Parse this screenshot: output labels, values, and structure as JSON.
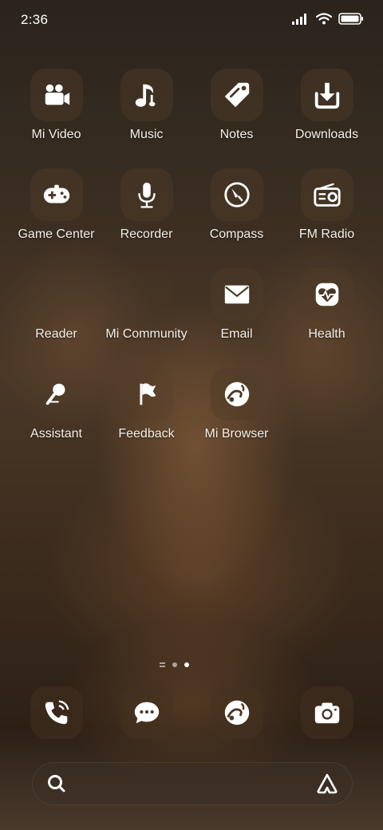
{
  "status_bar": {
    "time": "2:36",
    "icons": [
      "signal-icon",
      "wifi-icon",
      "battery-icon"
    ]
  },
  "apps": [
    {
      "label": "Mi Video",
      "icon": "video-camera-icon"
    },
    {
      "label": "Music",
      "icon": "music-note-icon"
    },
    {
      "label": "Notes",
      "icon": "notes-icon"
    },
    {
      "label": "Downloads",
      "icon": "download-icon"
    },
    {
      "label": "Game Center",
      "icon": "gamepad-icon"
    },
    {
      "label": "Recorder",
      "icon": "microphone-icon"
    },
    {
      "label": "Compass",
      "icon": "compass-icon"
    },
    {
      "label": "FM Radio",
      "icon": "radio-icon"
    },
    {
      "label": "Reader",
      "icon": "reader-icon"
    },
    {
      "label": "Mi Community",
      "icon": "community-icon"
    },
    {
      "label": "Email",
      "icon": "envelope-icon"
    },
    {
      "label": "Health",
      "icon": "heart-pulse-icon"
    },
    {
      "label": "Assistant",
      "icon": "assistant-mic-icon"
    },
    {
      "label": "Feedback",
      "icon": "flag-icon"
    },
    {
      "label": "Mi Browser",
      "icon": "browser-icon"
    }
  ],
  "page_indicator": {
    "pages": 3,
    "active": 2
  },
  "dock": [
    {
      "label": "Phone",
      "icon": "phone-icon"
    },
    {
      "label": "Messages",
      "icon": "message-icon"
    },
    {
      "label": "Browser",
      "icon": "browser-icon"
    },
    {
      "label": "Camera",
      "icon": "camera-icon"
    }
  ],
  "search": {
    "icon": "search-icon",
    "assistant_icon": "assistant-logo-icon"
  }
}
